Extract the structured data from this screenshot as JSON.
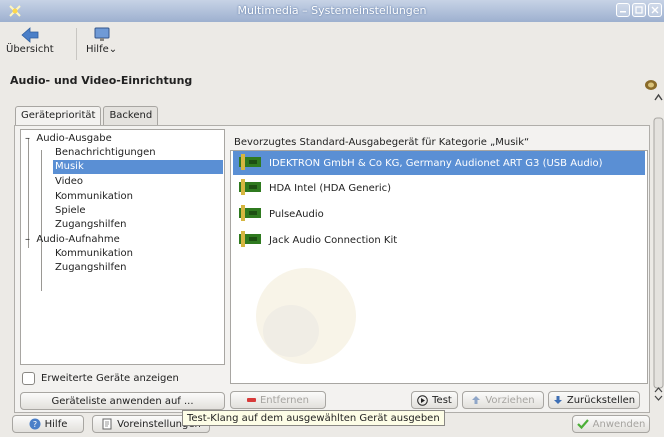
{
  "window": {
    "title": "Multimedia – Systemeinstellungen"
  },
  "toolbar": {
    "overview_label": "Übersicht",
    "help_label": "Hilfe⌄"
  },
  "page": {
    "heading": "Audio- und Video-Einrichtung"
  },
  "tabs": [
    {
      "label": "Gerätepriorität",
      "active": true
    },
    {
      "label": "Backend",
      "active": false
    }
  ],
  "tree": {
    "groups": [
      {
        "label": "Audio-Ausgabe",
        "children": [
          "Benachrichtigungen",
          "Musik",
          "Video",
          "Kommunikation",
          "Spiele",
          "Zugangshilfen"
        ]
      },
      {
        "label": "Audio-Aufnahme",
        "children": [
          "Kommunikation",
          "Zugangshilfen"
        ]
      }
    ],
    "selected": "Musik"
  },
  "advanced_checkbox_label": "Erweiterte Geräte anzeigen",
  "apply_list_button": "Geräteliste anwenden auf ...",
  "device_panel": {
    "label": "Bevorzugtes Standard-Ausgabegerät für Kategorie „Musik“",
    "devices": [
      {
        "name": "IDEKTRON GmbH & Co KG, Germany   Audionet ART G3 (USB Audio)",
        "selected": true
      },
      {
        "name": "HDA Intel (HDA Generic)",
        "selected": false
      },
      {
        "name": "PulseAudio",
        "selected": false
      },
      {
        "name": "Jack Audio Connection Kit",
        "selected": false
      }
    ]
  },
  "actions": {
    "remove": "Entfernen",
    "test": "Test",
    "prefer": "Vorziehen",
    "defer": "Zurückstellen"
  },
  "bottom": {
    "help": "Hilfe",
    "defaults": "Voreinstellungen",
    "apply": "Anwenden"
  },
  "tooltip": "Test-Klang auf dem ausgewählten Gerät ausgeben",
  "colors": {
    "selection": "#5a8fd4",
    "titlebar": "#9db0cf",
    "remove_icon": "#d83a3a",
    "apply_icon": "#4caf38"
  }
}
